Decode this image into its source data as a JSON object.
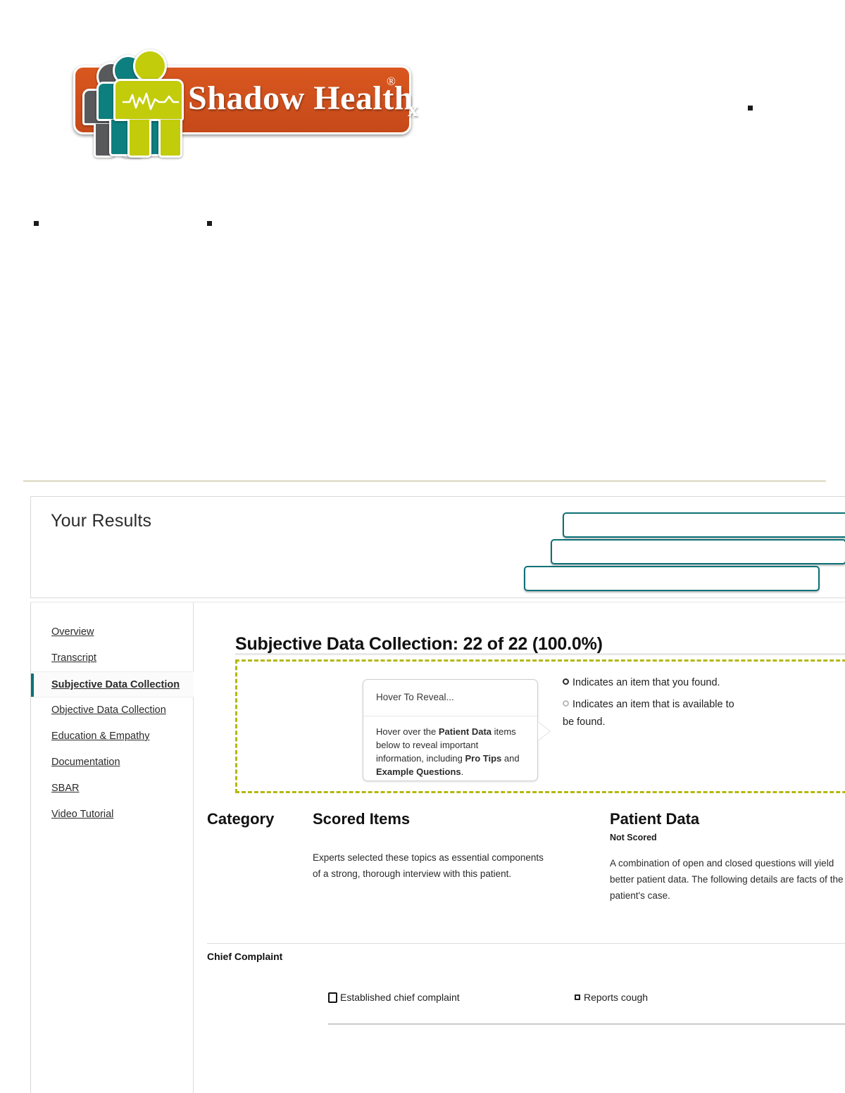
{
  "brand": {
    "name": "Shadow Health",
    "registered_mark": "®",
    "plate_color": "#d4521f",
    "figure_colors": [
      "#58595b",
      "#0e7f7f",
      "#c2cc0a"
    ]
  },
  "results_panel": {
    "title": "Your Results",
    "buttons": [
      {
        "label": ""
      },
      {
        "label": ""
      },
      {
        "label": ""
      }
    ],
    "accent_color": "#0c7076"
  },
  "sidebar": {
    "items": [
      {
        "label": "Overview",
        "active": false
      },
      {
        "label": "Transcript",
        "active": false
      },
      {
        "label": "Subjective Data Collection",
        "active": true
      },
      {
        "label": "Objective Data Collection",
        "active": false
      },
      {
        "label": "Education & Empathy",
        "active": false
      },
      {
        "label": "Documentation",
        "active": false
      },
      {
        "label": "SBAR",
        "active": false
      },
      {
        "label": "Video Tutorial",
        "active": false
      }
    ]
  },
  "main": {
    "section_title": "Subjective Data Collection: 22 of 22 (100.0%)",
    "score": {
      "earned": 22,
      "total": 22,
      "percent": "100.0%"
    },
    "hover_card": {
      "header": "Hover To Reveal...",
      "body_part1": "Hover over the ",
      "body_bold1": "Patient Data",
      "body_part2": " items below to reveal important information, including ",
      "body_bold2": "Pro Tips",
      "body_part3": " and ",
      "body_bold3": "Example Questions",
      "body_part4": "."
    },
    "legend": {
      "found": "Indicates an item that you found.",
      "available": "Indicates an item that is available to be found."
    },
    "columns": {
      "category": {
        "heading": "Category",
        "subheading": "",
        "description": ""
      },
      "scored_items": {
        "heading": "Scored Items",
        "subheading": "",
        "description": "Experts selected these topics as essential components of a strong, thorough interview with this patient."
      },
      "patient_data": {
        "heading": "Patient Data",
        "subheading": "Not Scored",
        "description": "A combination of open and closed questions will yield better patient data. The following details are facts of the patient's case."
      }
    },
    "rows": [
      {
        "category": "Chief Complaint",
        "scored_item": "Established chief complaint",
        "patient_data": "Reports cough"
      }
    ]
  },
  "dashed_border_color": "#b3b80c"
}
